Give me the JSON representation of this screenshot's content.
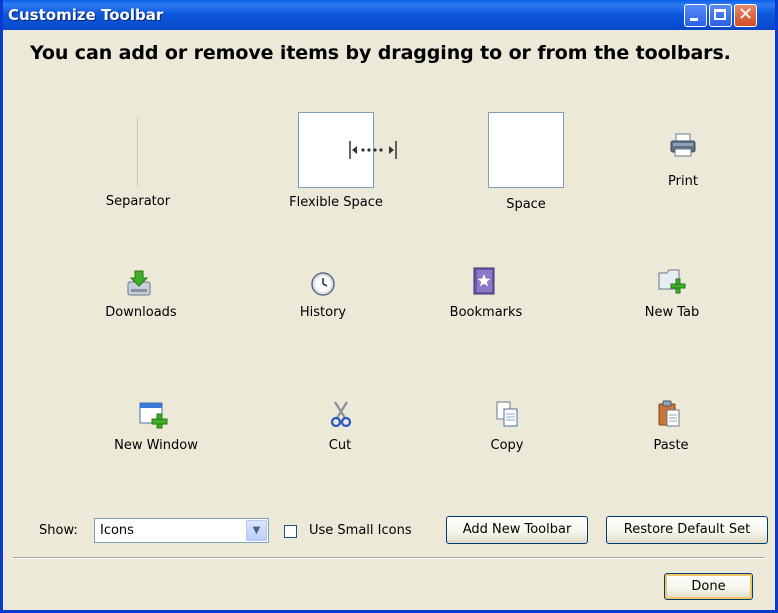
{
  "window": {
    "title": "Customize Toolbar"
  },
  "instruction": "You can add or remove items by dragging to or from the toolbars.",
  "items": [
    {
      "label": "Separator",
      "icon": "separator-icon"
    },
    {
      "label": "Flexible Space",
      "icon": "flexible-space-icon"
    },
    {
      "label": "Space",
      "icon": "space-icon"
    },
    {
      "label": "Print",
      "icon": "printer-icon"
    },
    {
      "label": "Downloads",
      "icon": "downloads-icon"
    },
    {
      "label": "History",
      "icon": "clock-icon"
    },
    {
      "label": "Bookmarks",
      "icon": "bookmarks-icon"
    },
    {
      "label": "New Tab",
      "icon": "new-tab-icon"
    },
    {
      "label": "New Window",
      "icon": "new-window-icon"
    },
    {
      "label": "Cut",
      "icon": "scissors-icon"
    },
    {
      "label": "Copy",
      "icon": "copy-icon"
    },
    {
      "label": "Paste",
      "icon": "paste-icon"
    }
  ],
  "controls": {
    "show_label": "Show:",
    "show_value": "Icons",
    "small_icons_label": "Use Small Icons",
    "small_icons_checked": false,
    "add_toolbar_label": "Add New Toolbar",
    "restore_label": "Restore Default Set",
    "done_label": "Done"
  },
  "colors": {
    "titlebar": "#0a4fd1",
    "dialog_bg": "#ece9d8",
    "close_button": "#d04a22"
  }
}
